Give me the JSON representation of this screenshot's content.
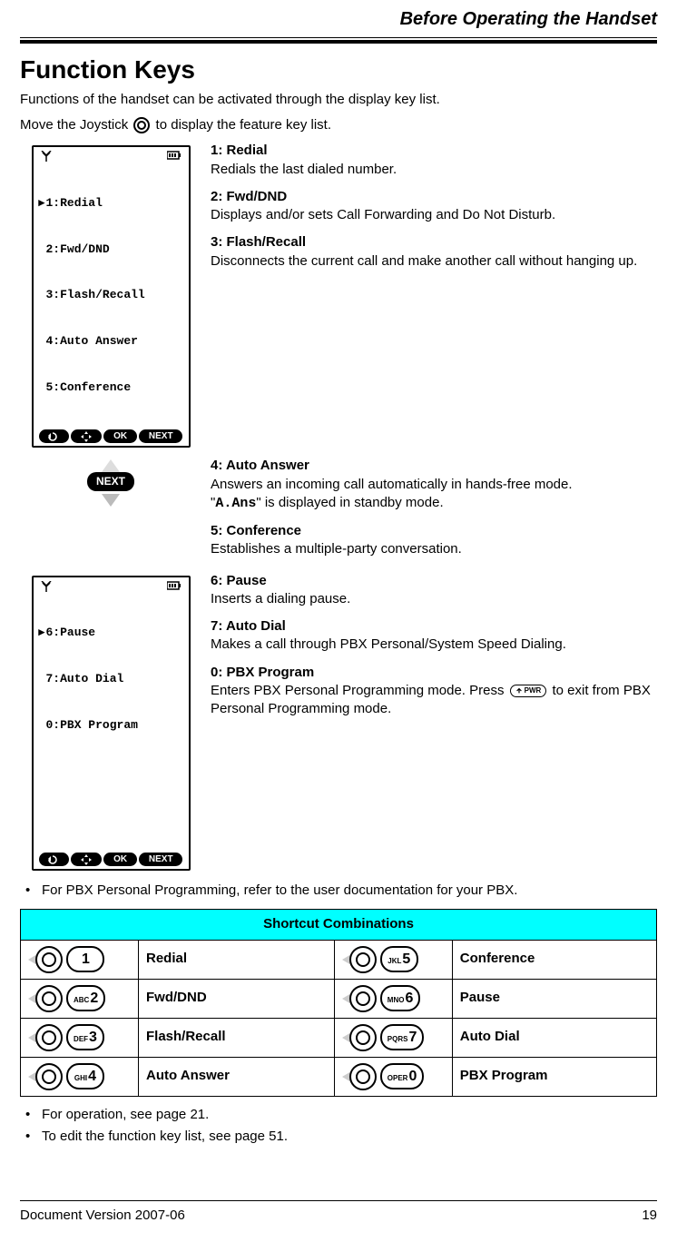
{
  "header": {
    "chapter": "Before Operating the Handset"
  },
  "title": "Function Keys",
  "intro": [
    "Functions of the handset can be activated through the display key list.",
    "Move the Joystick      to display the feature key list."
  ],
  "lcd1": {
    "lines": [
      "1:Redial",
      "2:Fwd/DND",
      "3:Flash/Recall",
      "4:Auto Answer",
      "5:Conference"
    ],
    "softkeys": [
      "↺",
      "✥",
      "OK",
      "NEXT"
    ]
  },
  "next_badge": "NEXT",
  "lcd2": {
    "lines": [
      "6:Pause",
      "7:Auto Dial",
      "0:PBX Program"
    ],
    "softkeys": [
      "↺",
      "✥",
      "OK",
      "NEXT"
    ]
  },
  "fkeys": [
    {
      "label": "1: Redial",
      "desc": "Redials the last dialed number."
    },
    {
      "label": "2: Fwd/DND",
      "desc": "Displays and/or sets Call Forwarding and Do Not Disturb."
    },
    {
      "label": "3: Flash/Recall",
      "desc": "Disconnects the current call and make another call without hanging up."
    },
    {
      "label": "4: Auto Answer",
      "desc_pre": "Answers an incoming call automatically in hands-free mode.\n\"",
      "code": "A.Ans",
      "desc_post": "\" is displayed in standby mode."
    },
    {
      "label": "5: Conference",
      "desc": "Establishes a multiple-party conversation."
    },
    {
      "label": "6: Pause",
      "desc": "Inserts a dialing pause."
    },
    {
      "label": "7: Auto Dial",
      "desc": "Makes a call through PBX Personal/System Speed Dialing."
    },
    {
      "label": "0: PBX Program",
      "desc_pre": "Enters PBX Personal Programming mode. Press ",
      "desc_post": " to exit from PBX Personal Programming mode."
    }
  ],
  "notes_before_table": "For PBX Personal Programming, refer to the user documentation for your PBX.",
  "table": {
    "header": "Shortcut Combinations",
    "rows": [
      {
        "leftKey": {
          "small": "",
          "big": "1"
        },
        "leftLabel": "Redial",
        "rightKey": {
          "small": "JKL",
          "big": "5"
        },
        "rightLabel": "Conference"
      },
      {
        "leftKey": {
          "small": "ABC",
          "big": "2"
        },
        "leftLabel": "Fwd/DND",
        "rightKey": {
          "small": "MNO",
          "big": "6"
        },
        "rightLabel": "Pause"
      },
      {
        "leftKey": {
          "small": "DEF",
          "big": "3"
        },
        "leftLabel": "Flash/Recall",
        "rightKey": {
          "small": "PQRS",
          "big": "7"
        },
        "rightLabel": "Auto Dial"
      },
      {
        "leftKey": {
          "small": "GHI",
          "big": "4"
        },
        "leftLabel": "Auto Answer",
        "rightKey": {
          "small": "OPER",
          "big": "0"
        },
        "rightLabel": "PBX Program"
      }
    ]
  },
  "notes_after_table": [
    "For operation, see page 21.",
    "To edit the function key list, see page 51."
  ],
  "footer": {
    "left": "Document Version 2007-06",
    "right": "19"
  },
  "pwr_label": "PWR"
}
